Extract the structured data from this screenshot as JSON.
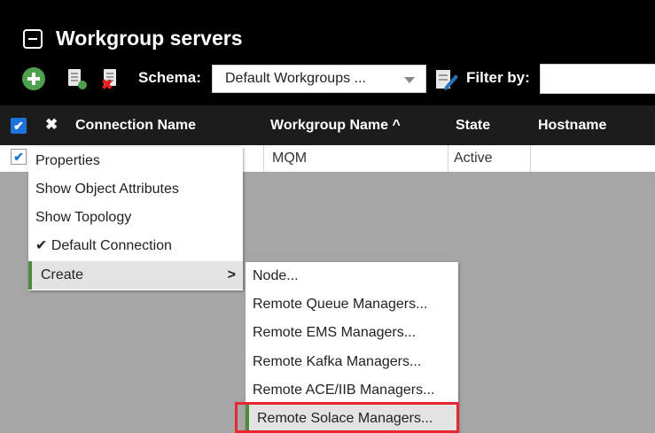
{
  "panel": {
    "title": "Workgroup servers"
  },
  "toolbar": {
    "schema_label": "Schema:",
    "schema_value": "Default Workgroups ...",
    "filter_label": "Filter by:",
    "filter_value": ""
  },
  "table": {
    "columns": {
      "select_all": "✔",
      "clear": "✖",
      "connection_name": "Connection Name",
      "workgroup_name": "Workgroup Name ^",
      "state": "State",
      "hostname": "Hostname"
    },
    "rows": [
      {
        "checked": "✔",
        "connection_name": "",
        "workgroup_name": "MQM",
        "state": "Active",
        "hostname": ""
      }
    ]
  },
  "context_menu": {
    "items": [
      {
        "label": "Properties"
      },
      {
        "label": "Show Object Attributes"
      },
      {
        "label": "Show Topology"
      },
      {
        "label": "✔ Default Connection"
      },
      {
        "label": "Create",
        "submenu_arrow": ">"
      }
    ]
  },
  "submenu": {
    "items": [
      {
        "label": "Node..."
      },
      {
        "label": "Remote Queue Managers..."
      },
      {
        "label": "Remote EMS Managers..."
      },
      {
        "label": "Remote Kafka Managers..."
      },
      {
        "label": "Remote ACE/IIB Managers..."
      },
      {
        "label": "Remote Solace Managers..."
      }
    ]
  },
  "colors": {
    "header_bg": "#000000",
    "column_header_bg": "#1c1c1c",
    "accent_green": "#4e8a3e",
    "checkbox_blue": "#1e73d8",
    "highlight_red": "#e8262f"
  },
  "icons": [
    "collapse-icon",
    "add-server-icon",
    "new-document-icon",
    "delete-document-icon",
    "edit-schema-icon",
    "chevron-right-icon"
  ]
}
